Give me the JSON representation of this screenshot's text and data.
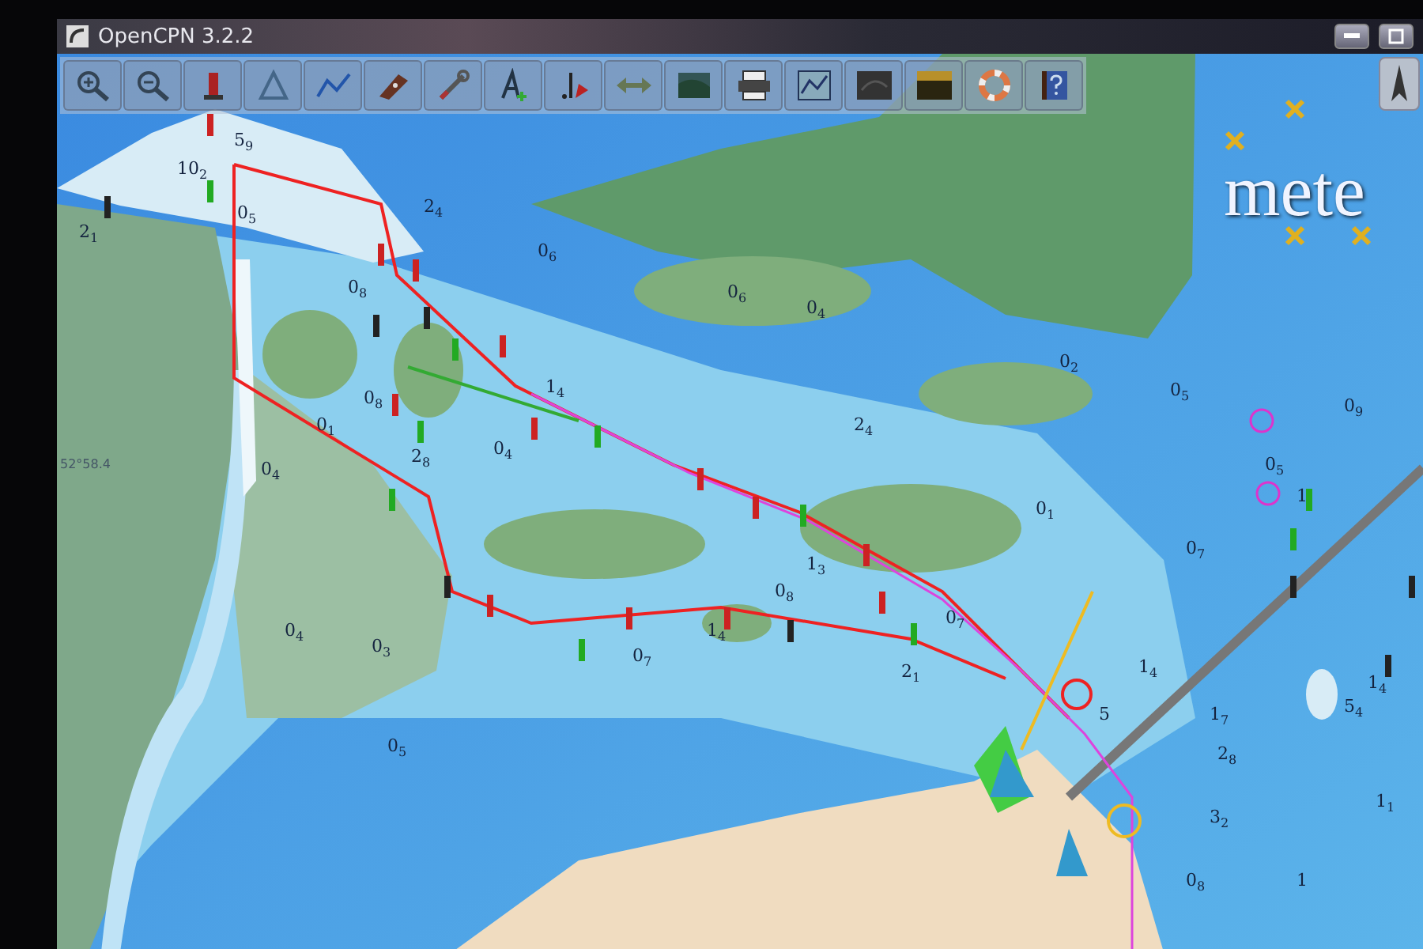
{
  "window": {
    "title": "OpenCPN 3.2.2"
  },
  "toolbar": {
    "buttons": [
      {
        "kind": "zoom-in"
      },
      {
        "kind": "zoom-out"
      },
      {
        "kind": "scale-up"
      },
      {
        "kind": "scale-down"
      },
      {
        "kind": "route"
      },
      {
        "kind": "ship"
      },
      {
        "kind": "tools"
      },
      {
        "kind": "text"
      },
      {
        "kind": "current"
      },
      {
        "kind": "stretch"
      },
      {
        "kind": "mode"
      },
      {
        "kind": "print"
      },
      {
        "kind": "route-manager"
      },
      {
        "kind": "track"
      },
      {
        "kind": "color-scheme"
      },
      {
        "kind": "mob"
      },
      {
        "kind": "help"
      }
    ]
  },
  "chart": {
    "overlay_text": "mete",
    "position_label": "52°58.4",
    "soundings": [
      {
        "text": "5$_{9}$"
      },
      {
        "text": "10$_{2}$"
      },
      {
        "text": "0$_{5}$"
      },
      {
        "text": "2$_{4}$"
      },
      {
        "text": "2$_{1}$"
      },
      {
        "text": "0$_{6}$"
      },
      {
        "text": "0$_{8}$"
      },
      {
        "text": "0$_{6}$"
      },
      {
        "text": "0$_{4}$"
      },
      {
        "text": "0$_{8}$"
      },
      {
        "text": "1$_{4}$"
      },
      {
        "text": "0$_{1}$"
      },
      {
        "text": "2$_{8}$"
      },
      {
        "text": "0$_{4}$"
      },
      {
        "text": "0$_{4}$"
      },
      {
        "text": "2$_{4}$"
      },
      {
        "text": "0$_{2}$"
      },
      {
        "text": "0$_{5}$"
      },
      {
        "text": "0$_{9}$"
      },
      {
        "text": "0$_{5}$"
      },
      {
        "text": "1"
      },
      {
        "text": "0$_{1}$"
      },
      {
        "text": "0$_{7}$"
      },
      {
        "text": "1$_{3}$"
      },
      {
        "text": "0$_{8}$"
      },
      {
        "text": "0$_{4}$"
      },
      {
        "text": "0$_{3}$"
      },
      {
        "text": "0$_{7}$"
      },
      {
        "text": "1$_{4}$"
      },
      {
        "text": "2$_{1}$"
      },
      {
        "text": "0$_{7}$"
      },
      {
        "text": "1$_{4}$"
      },
      {
        "text": "1$_{7}$"
      },
      {
        "text": "2$_{8}$"
      },
      {
        "text": "5$_{4}$"
      },
      {
        "text": "1$_{4}$"
      },
      {
        "text": "0$_{5}$"
      },
      {
        "text": "3$_{2}$"
      },
      {
        "text": "1$_{1}$"
      },
      {
        "text": "1"
      },
      {
        "text": "0$_{8}$"
      },
      {
        "text": "5"
      }
    ]
  }
}
